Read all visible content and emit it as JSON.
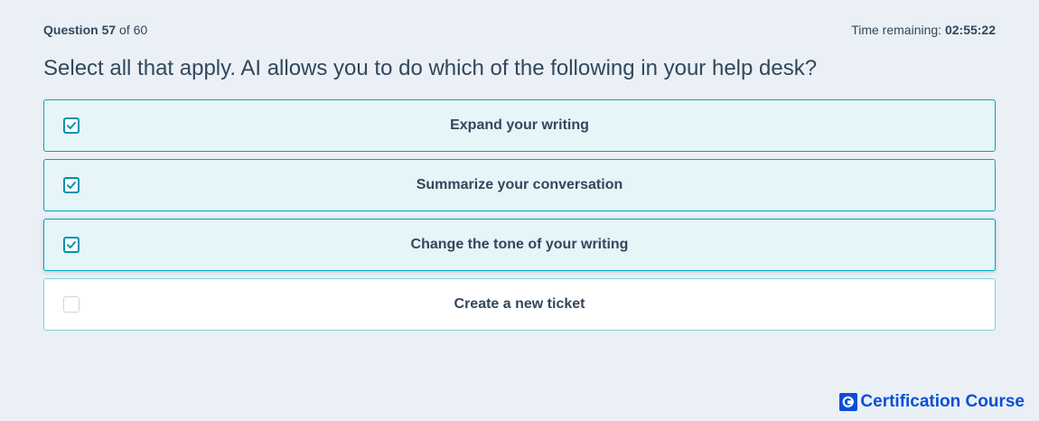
{
  "header": {
    "question_prefix": "Question",
    "question_number": "57",
    "question_of": "of 60",
    "time_label": "Time remaining:",
    "time_value": "02:55:22"
  },
  "question": {
    "text": "Select all that apply. AI allows you to do which of the following in your help desk?"
  },
  "options": [
    {
      "label": "Expand your writing",
      "checked": true
    },
    {
      "label": "Summarize your conversation",
      "checked": true
    },
    {
      "label": "Change the tone of your writing",
      "checked": true
    },
    {
      "label": "Create a new ticket",
      "checked": false
    }
  ],
  "branding": {
    "icon": "g-logo-icon",
    "name": "Certification Course"
  },
  "colors": {
    "background": "#eaf0f6",
    "accent": "#00a4bd",
    "selected_fill": "#e5f5f8",
    "text": "#33475b",
    "brand": "#0b4fd6"
  }
}
